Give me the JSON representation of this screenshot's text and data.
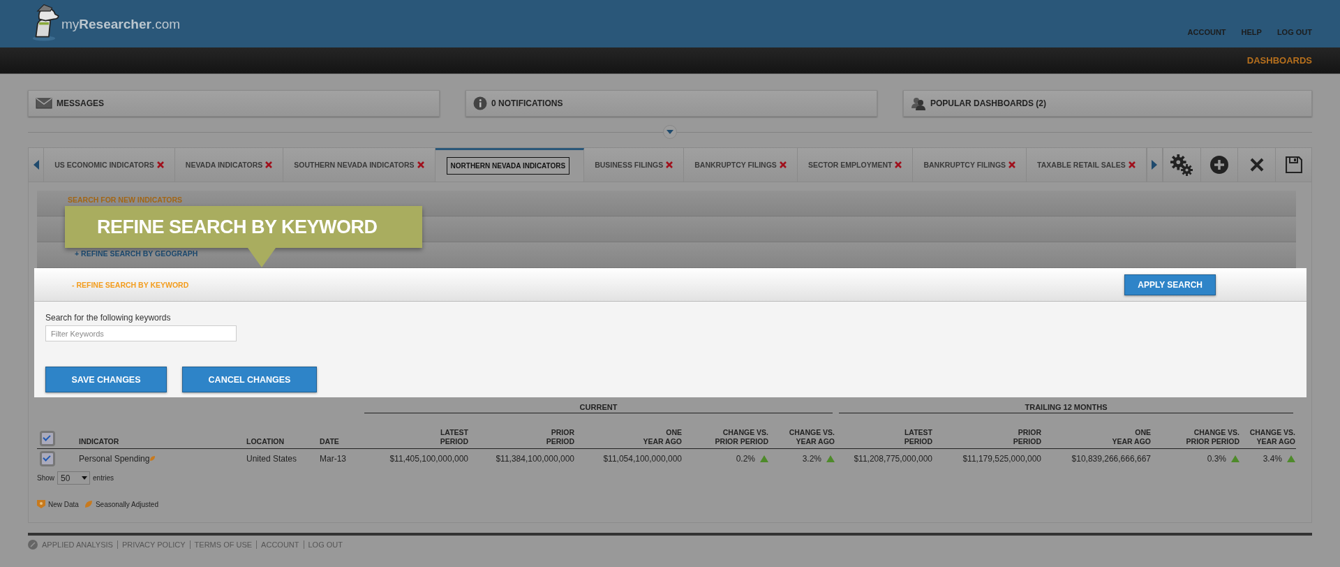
{
  "header": {
    "logo": "my**Researcher**.com",
    "links": [
      "ACCOUNT",
      "HELP",
      "LOG OUT"
    ]
  },
  "nav": [
    {
      "label": "DASHBOARDS",
      "selected": true
    }
  ],
  "info_boxes": [
    {
      "kind": "mail",
      "label": "MESSAGES"
    },
    {
      "kind": "info",
      "label": "0 NOTIFICATIONS"
    },
    {
      "kind": "people",
      "label": "POPULAR DASHBOARDS (2)"
    }
  ],
  "tabs": [
    {
      "label": "US ECONOMIC INDICATORS",
      "selected": false,
      "closable": true
    },
    {
      "label": "NEVADA INDICATORS",
      "selected": false,
      "closable": true
    },
    {
      "label": "SOUTHERN NEVADA INDICATORS",
      "selected": false,
      "closable": true
    },
    {
      "label": "NORTHERN NEVADA INDICATORS",
      "selected": true,
      "closable": false
    },
    {
      "label": "BUSINESS FILINGS",
      "selected": false,
      "closable": true
    },
    {
      "label": "BANKRUPTCY FILINGS",
      "selected": false,
      "closable": true
    },
    {
      "label": "SECTOR EMPLOYMENT",
      "selected": false,
      "closable": true
    },
    {
      "label": "BANKRUPTCY FILINGS",
      "selected": false,
      "closable": true
    },
    {
      "label": "TAXABLE RETAIL SALES",
      "selected": false,
      "closable": true
    }
  ],
  "callout": {
    "text": "REFINE SEARCH BY KEYWORD"
  },
  "accordion": [
    {
      "kind": "heading",
      "label": "SEARCH FOR NEW INDICATORS"
    },
    {
      "kind": "blank"
    },
    {
      "kind": "section",
      "label": "+ REFINE SEARCH BY GEOGRAPH",
      "expanded": false
    },
    {
      "kind": "section",
      "label": "- REFINE SEARCH BY KEYWORD",
      "expanded": true
    }
  ],
  "keyword_panel": {
    "apply_button": "APPLY SEARCH",
    "field_label": "Search for the following keywords",
    "placeholder": "Filter Keywords",
    "buttons": [
      "SAVE CHANGES",
      "CANCEL CHANGES"
    ]
  },
  "table": {
    "groups": [
      {
        "label": "CURRENT"
      },
      {
        "label": "TRAILING 12 MONTHS"
      }
    ],
    "header_checked": true,
    "columns": [
      "INDICATOR",
      "LOCATION",
      "DATE",
      "LATEST\nPERIOD",
      "PRIOR\nPERIOD",
      "ONE\nYEAR AGO",
      "CHANGE VS.\nPRIOR PERIOD",
      "CHANGE VS.\nYEAR AGO",
      "LATEST\nPERIOD",
      "PRIOR\nPERIOD",
      "ONE\nYEAR AGO",
      "CHANGE VS.\nPRIOR PERIOD",
      "CHANGE VS.\nYEAR AGO"
    ],
    "rows": [
      {
        "checked": true,
        "seasonally_adjusted": true,
        "cells": [
          {
            "text": "Personal Spending"
          },
          {
            "text": "United States"
          },
          {
            "text": "Mar-13"
          },
          {
            "text": "$11,405,100,000,000"
          },
          {
            "text": "$11,384,100,000,000"
          },
          {
            "text": "$11,054,100,000,000"
          },
          {
            "text": "0.2%",
            "rising": true
          },
          {
            "text": "3.2%",
            "rising": true
          },
          {
            "text": "$11,208,775,000,000"
          },
          {
            "text": "$11,179,525,000,000"
          },
          {
            "text": "$10,839,266,666,667"
          },
          {
            "text": "0.3%",
            "rising": true
          },
          {
            "text": "3.4%",
            "rising": true
          }
        ]
      }
    ]
  },
  "entries": {
    "label_before": "Show",
    "value": "50",
    "label_after": "entries"
  },
  "legend": [
    {
      "kind": "new",
      "label": "New Data"
    },
    {
      "kind": "seasonal",
      "label": "Seasonally Adjusted"
    }
  ],
  "footer": [
    "APPLIED ANALYSIS",
    "PRIVACY POLICY",
    "TERMS OF USE",
    "ACCOUNT",
    "LOG OUT"
  ]
}
